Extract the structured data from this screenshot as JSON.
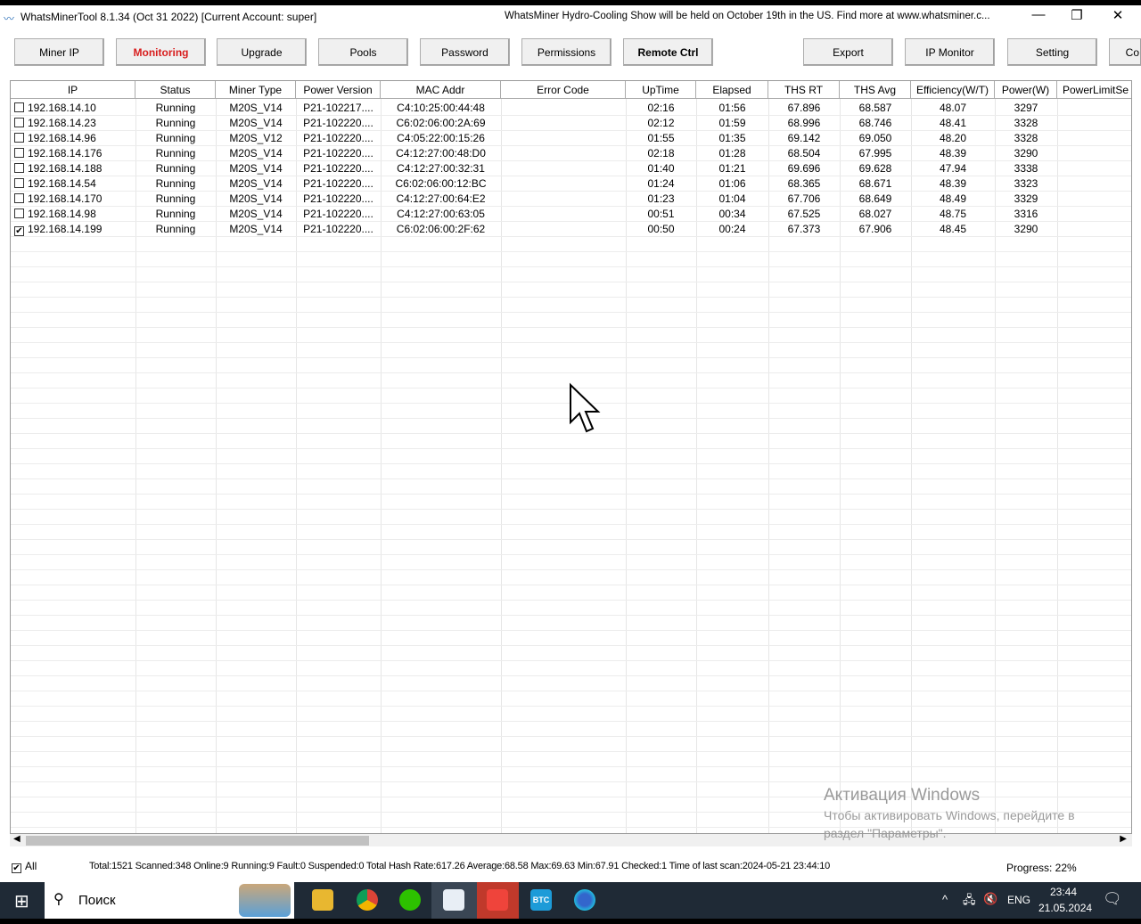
{
  "window": {
    "title": "WhatsMinerTool 8.1.34 (Oct 31 2022) [Current Account: super]",
    "banner": "WhatsMiner Hydro-Cooling Show will be held on October 19th in the US. Find more at www.whatsminer.c...",
    "minimize": "—",
    "restore": "❐",
    "close": "✕"
  },
  "toolbar": {
    "buttons": [
      "Miner IP",
      "Monitoring",
      "Upgrade",
      "Pools",
      "Password",
      "Permissions",
      "Remote Ctrl",
      "Export",
      "IP Monitor",
      "Setting",
      "Co"
    ],
    "active": "Monitoring",
    "accent": "#d81e1e"
  },
  "table": {
    "columns": [
      "IP",
      "Status",
      "Miner Type",
      "Power Version",
      "MAC Addr",
      "Error Code",
      "UpTime",
      "Elapsed",
      "THS RT",
      "THS Avg",
      "Efficiency(W/T)",
      "Power(W)",
      "PowerLimitSe"
    ],
    "rows": [
      {
        "checked": false,
        "cells": [
          "192.168.14.10",
          "Running",
          "M20S_V14",
          "P21-102217....",
          "C4:10:25:00:44:48",
          "",
          "02:16",
          "01:56",
          "67.896",
          "68.587",
          "48.07",
          "3297",
          ""
        ]
      },
      {
        "checked": false,
        "cells": [
          "192.168.14.23",
          "Running",
          "M20S_V14",
          "P21-102220....",
          "C6:02:06:00:2A:69",
          "",
          "02:12",
          "01:59",
          "68.996",
          "68.746",
          "48.41",
          "3328",
          ""
        ]
      },
      {
        "checked": false,
        "cells": [
          "192.168.14.96",
          "Running",
          "M20S_V12",
          "P21-102220....",
          "C4:05:22:00:15:26",
          "",
          "01:55",
          "01:35",
          "69.142",
          "69.050",
          "48.20",
          "3328",
          ""
        ]
      },
      {
        "checked": false,
        "cells": [
          "192.168.14.176",
          "Running",
          "M20S_V14",
          "P21-102220....",
          "C4:12:27:00:48:D0",
          "",
          "02:18",
          "01:28",
          "68.504",
          "67.995",
          "48.39",
          "3290",
          ""
        ]
      },
      {
        "checked": false,
        "cells": [
          "192.168.14.188",
          "Running",
          "M20S_V14",
          "P21-102220....",
          "C4:12:27:00:32:31",
          "",
          "01:40",
          "01:21",
          "69.696",
          "69.628",
          "47.94",
          "3338",
          ""
        ]
      },
      {
        "checked": false,
        "cells": [
          "192.168.14.54",
          "Running",
          "M20S_V14",
          "P21-102220....",
          "C6:02:06:00:12:BC",
          "",
          "01:24",
          "01:06",
          "68.365",
          "68.671",
          "48.39",
          "3323",
          ""
        ]
      },
      {
        "checked": false,
        "cells": [
          "192.168.14.170",
          "Running",
          "M20S_V14",
          "P21-102220....",
          "C4:12:27:00:64:E2",
          "",
          "01:23",
          "01:04",
          "67.706",
          "68.649",
          "48.49",
          "3329",
          ""
        ]
      },
      {
        "checked": false,
        "cells": [
          "192.168.14.98",
          "Running",
          "M20S_V14",
          "P21-102220....",
          "C4:12:27:00:63:05",
          "",
          "00:51",
          "00:34",
          "67.525",
          "68.027",
          "48.75",
          "3316",
          ""
        ]
      },
      {
        "checked": true,
        "cells": [
          "192.168.14.199",
          "Running",
          "M20S_V14",
          "P21-102220....",
          "C6:02:06:00:2F:62",
          "",
          "00:50",
          "00:24",
          "67.373",
          "67.906",
          "48.45",
          "3290",
          ""
        ]
      }
    ]
  },
  "status": {
    "all_label": "All",
    "all_checked": true,
    "summary": "Total:1521  Scanned:348  Online:9  Running:9  Fault:0  Suspended:0  Total Hash Rate:617.26  Average:68.58  Max:69.63  Min:67.91  Checked:1  Time of last scan:2024-05-21 23:44:10",
    "progress": "Progress: 22%"
  },
  "activation": {
    "title": "Активация Windows",
    "line1": "Чтобы активировать Windows, перейдите в",
    "line2": "раздел \"Параметры\"."
  },
  "taskbar": {
    "search": "Поиск",
    "lang": "ENG",
    "time": "23:44",
    "date": "21.05.2024"
  }
}
